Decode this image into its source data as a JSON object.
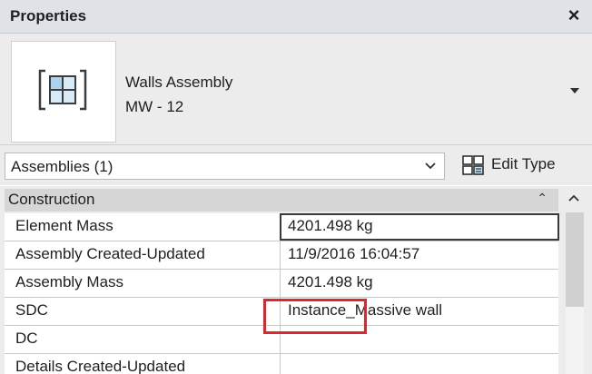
{
  "window": {
    "title": "Properties",
    "close_label": "×"
  },
  "type_selector": {
    "family": "Walls Assembly",
    "type_name": "MW - 12",
    "icon": "assembly-icon"
  },
  "filter": {
    "selected": "Assemblies (1)",
    "edit_type_label": "Edit Type"
  },
  "group": {
    "label": "Construction",
    "collapse_glyph": "⌃"
  },
  "rows": [
    {
      "name": "Element Mass",
      "value": "4201.498 kg"
    },
    {
      "name": "Assembly Created-Updated",
      "value": "11/9/2016 16:04:57"
    },
    {
      "name": "Assembly Mass",
      "value": "4201.498 kg"
    },
    {
      "name": "SDC",
      "value": "Instance_Massive wall"
    },
    {
      "name": "DC",
      "value": ""
    },
    {
      "name": "Details Created-Updated",
      "value": ""
    }
  ],
  "scrollbar": {
    "position": 0.0
  }
}
